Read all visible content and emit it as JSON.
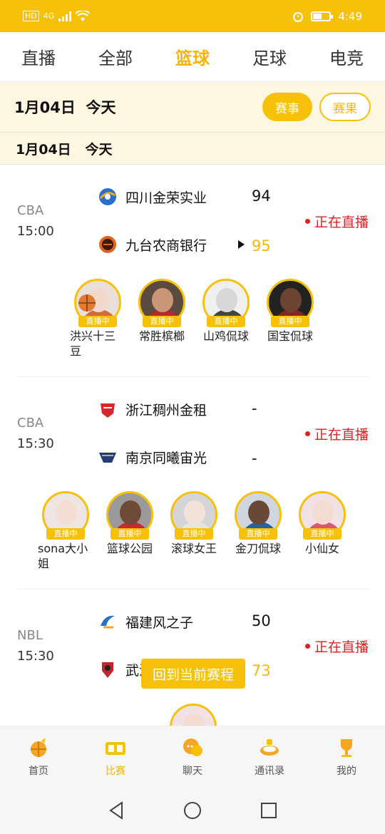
{
  "status_bar": {
    "left_badge": "HD",
    "network": "4G",
    "time": "4:49",
    "battery_level_pct": 55
  },
  "tabs": [
    {
      "label": "直播",
      "active": false
    },
    {
      "label": "全部",
      "active": false
    },
    {
      "label": "篮球",
      "active": true
    },
    {
      "label": "足球",
      "active": false
    },
    {
      "label": "电竞",
      "active": false
    }
  ],
  "date_header": {
    "title": "1月04日  今天",
    "btn_events": "赛事",
    "btn_schedule": "赛果"
  },
  "sub_date": "1月04日   今天",
  "matches": [
    {
      "league": "CBA",
      "time": "15:00",
      "home": {
        "name": "四川金荣实业",
        "score": "94",
        "logo_color": "#2a6fc9"
      },
      "away": {
        "name": "九台农商银行",
        "score": "95",
        "logo_color": "#e0651a",
        "winning": true
      },
      "status": "正在直播",
      "streamers": [
        {
          "name": "洪兴十三\n豆",
          "face": "#f3d9cc",
          "body": "#d46a3a",
          "bg": "#e9e0dc"
        },
        {
          "name": "常胜槟榔",
          "face": "#c99778",
          "body": "#b8282c",
          "bg": "#5a4a40"
        },
        {
          "name": "山鸡侃球",
          "face": "#d8d8d8",
          "body": "#444444",
          "bg": "#f0f0f0"
        },
        {
          "name": "国宝侃球",
          "face": "#6b4532",
          "body": "#8a2525",
          "bg": "#222222"
        }
      ]
    },
    {
      "league": "CBA",
      "time": "15:30",
      "home": {
        "name": "浙江稠州金租",
        "score": "-",
        "logo_color": "#d8262c"
      },
      "away": {
        "name": "南京同曦宙光",
        "score": "-",
        "logo_color": "#1d3c7a"
      },
      "status": "正在直播",
      "streamers": [
        {
          "name": "sona大小\n姐",
          "face": "#f4ddd3",
          "body": "#f0e6e0",
          "bg": "#efe6e4"
        },
        {
          "name": "篮球公园",
          "face": "#6e4a38",
          "body": "#c72b2b",
          "bg": "#9a9a9a"
        },
        {
          "name": "滚球女王",
          "face": "#f3e2da",
          "body": "#e5e5e5",
          "bg": "#d5d5d5"
        },
        {
          "name": "金刀侃球",
          "face": "#6a4838",
          "body": "#2a5fa8",
          "bg": "#cfd6e0"
        },
        {
          "name": "小仙女",
          "face": "#f4dcd2",
          "body": "#d65a6a",
          "bg": "#f2e2e6"
        }
      ]
    },
    {
      "league": "NBL",
      "time": "15:30",
      "home": {
        "name": "福建风之子",
        "score": "50",
        "logo_color": "#2a6fc9"
      },
      "away": {
        "name": "武汉",
        "score": "73",
        "logo_color": "#c0262c",
        "winning": true
      },
      "status": "正在直播"
    }
  ],
  "back_button": "回到当前赛程",
  "bottom_nav": [
    {
      "label": "首页",
      "icon": "basketball-home-icon",
      "active": false
    },
    {
      "label": "比赛",
      "icon": "scoreboard-icon",
      "active": true
    },
    {
      "label": "聊天",
      "icon": "chat-bubble-icon",
      "active": false
    },
    {
      "label": "通讯录",
      "icon": "stadium-icon",
      "active": false
    },
    {
      "label": "我的",
      "icon": "trophy-icon",
      "active": false
    }
  ],
  "colors": {
    "accent": "#f7c10a",
    "live": "#e02020",
    "tint": "#fdf6e1"
  }
}
